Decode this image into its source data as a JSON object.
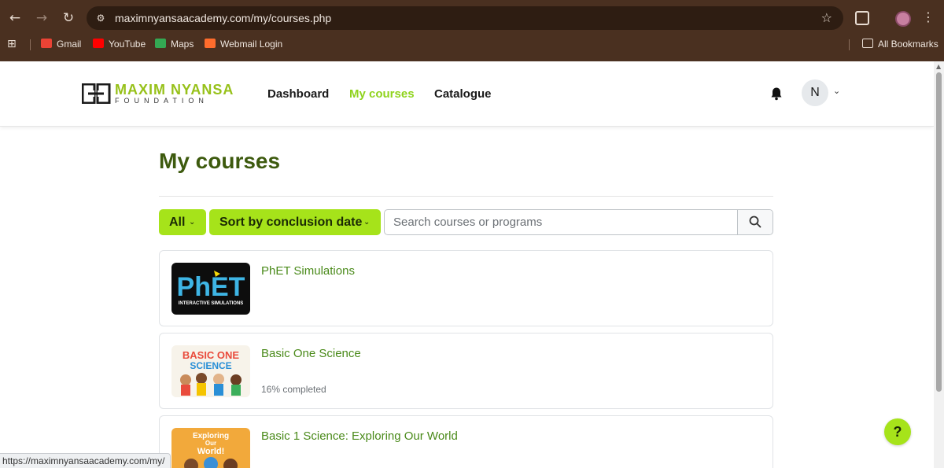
{
  "browser": {
    "url": "maximnyansaacademy.com/my/courses.php",
    "bookmarks": [
      {
        "label": "Gmail",
        "color": "#ea4335"
      },
      {
        "label": "YouTube",
        "color": "#ff0000"
      },
      {
        "label": "Maps",
        "color": "#34a853"
      },
      {
        "label": "Webmail Login",
        "color": "#ff6c2c"
      }
    ],
    "all_bookmarks_label": "All Bookmarks",
    "status_url": "https://maximnyansaacademy.com/my/"
  },
  "site": {
    "logo_title": "MAXIM NYANSA",
    "logo_subtitle": "FOUNDATION",
    "nav": [
      {
        "label": "Dashboard",
        "active": false
      },
      {
        "label": "My courses",
        "active": true
      },
      {
        "label": "Catalogue",
        "active": false
      }
    ],
    "user_initial": "N",
    "accent_color": "#a6e31a"
  },
  "main": {
    "title": "My courses",
    "filter_all_label": "All",
    "sort_label": "Sort by conclusion date",
    "search_placeholder": "Search courses or programs",
    "courses": [
      {
        "title": "PhET Simulations",
        "progress": "",
        "thumb": "phet"
      },
      {
        "title": "Basic One Science",
        "progress": "16% completed",
        "thumb": "basic-one-science"
      },
      {
        "title": "Basic 1 Science: Exploring Our World",
        "progress": "",
        "thumb": "exploring-our-world"
      }
    ],
    "thumb_text": {
      "phet": "PhET",
      "phet_sub": "INTERACTIVE SIMULATIONS",
      "basic_one": "BASIC ONE",
      "science": "SCIENCE",
      "exploring": "Exploring",
      "our": "Our",
      "world": "World!"
    }
  },
  "help_label": "?"
}
